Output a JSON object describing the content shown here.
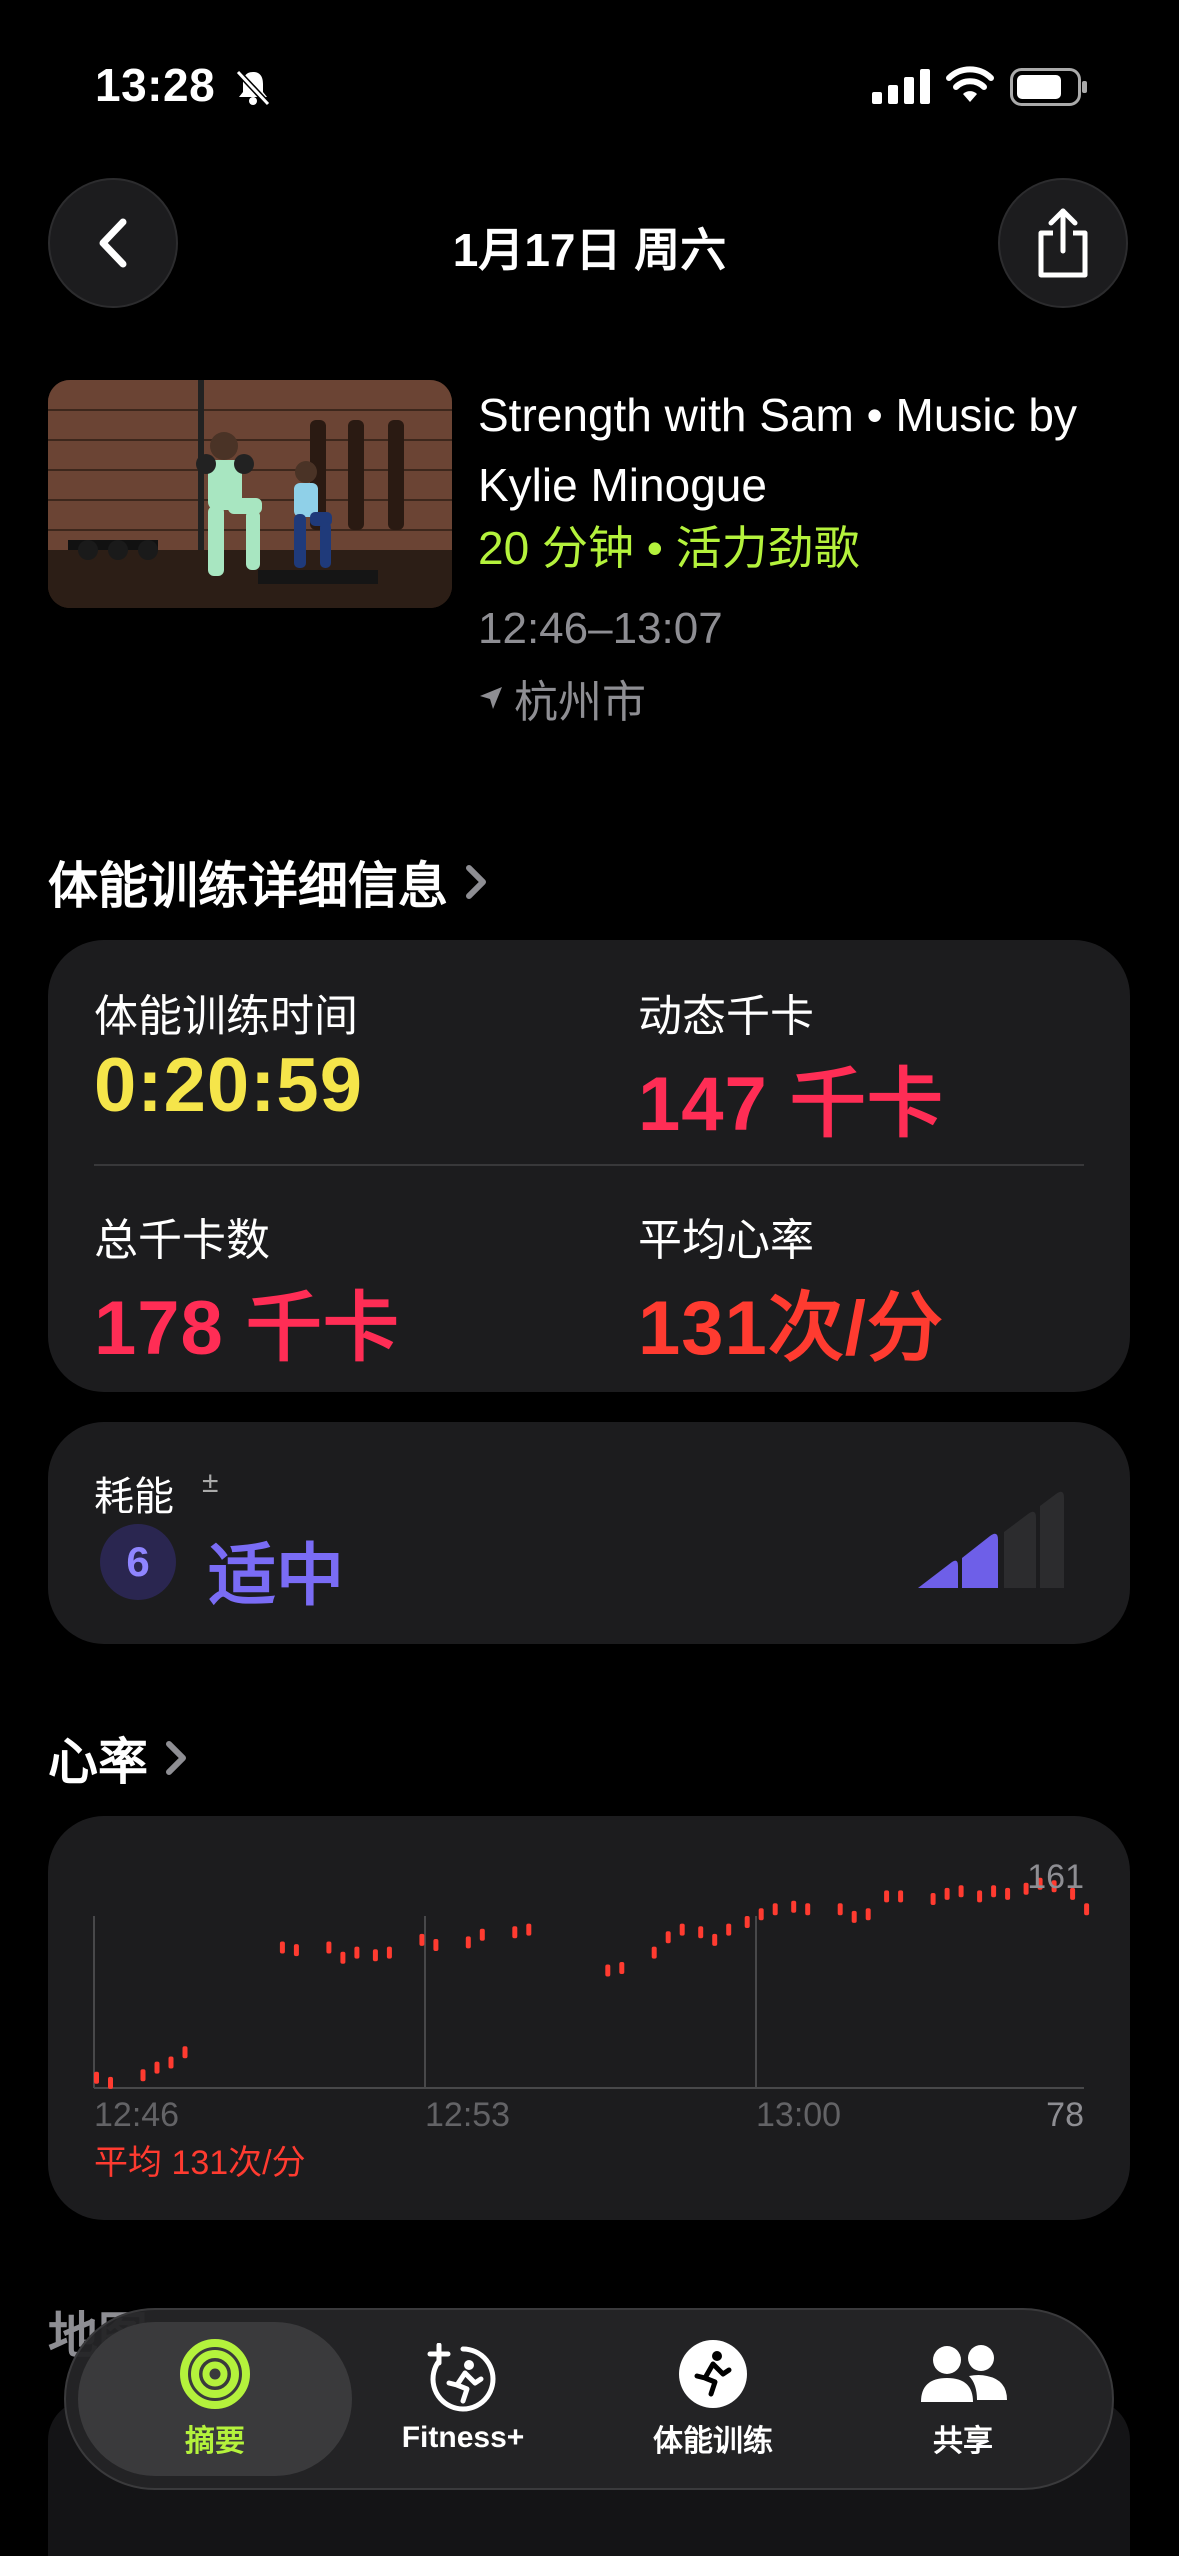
{
  "status_bar": {
    "time": "13:28"
  },
  "header": {
    "date": "1月17日 周六"
  },
  "workout": {
    "title": "Strength with Sam • Music by Kylie Minogue",
    "subtitle": "20 分钟 • 活力劲歌",
    "time_range": "12:46–13:07",
    "location": "杭州市"
  },
  "details": {
    "section_title": "体能训练详细信息",
    "metrics": [
      {
        "label": "体能训练时间",
        "value": "0:20:59",
        "color": "#f5e54a"
      },
      {
        "label": "动态千卡",
        "value": "147 千卡",
        "color": "#ff2d55"
      },
      {
        "label": "总千卡数",
        "value": "178 千卡",
        "color": "#ff2d55"
      },
      {
        "label": "平均心率",
        "value": "131次/分",
        "color": "#ff3b30"
      }
    ]
  },
  "effort": {
    "label": "耗能",
    "plus_minus": "±",
    "level": "6",
    "level_text": "适中",
    "color": "#7a6cf5"
  },
  "heart_rate": {
    "section_title": "心率",
    "average": "平均 131次/分"
  },
  "chart_data": {
    "type": "scatter",
    "title": "",
    "xlabel": "",
    "ylabel": "",
    "x_ticks": [
      "12:46",
      "12:53",
      "13:00"
    ],
    "y_max_label": "161",
    "y_min_label": "78",
    "ylim": [
      78,
      161
    ],
    "series": [
      {
        "values": [
          [
            "12:46",
            82
          ],
          [
            "12:46",
            80
          ],
          [
            "12:47",
            83
          ],
          [
            "12:47",
            86
          ],
          [
            "12:47",
            88
          ],
          [
            "12:47",
            92
          ],
          [
            "12:50",
            133
          ],
          [
            "12:50",
            132
          ],
          [
            "12:51",
            133
          ],
          [
            "12:51",
            129
          ],
          [
            "12:51",
            131
          ],
          [
            "12:52",
            130
          ],
          [
            "12:52",
            131
          ],
          [
            "12:53",
            136
          ],
          [
            "12:53",
            134
          ],
          [
            "12:54",
            135
          ],
          [
            "12:54",
            138
          ],
          [
            "12:55",
            139
          ],
          [
            "12:55",
            140
          ],
          [
            "12:57",
            124
          ],
          [
            "12:57",
            125
          ],
          [
            "12:58",
            131
          ],
          [
            "12:58",
            137
          ],
          [
            "12:58",
            140
          ],
          [
            "12:59",
            139
          ],
          [
            "12:59",
            136
          ],
          [
            "12:59",
            140
          ],
          [
            "13:00",
            143
          ],
          [
            "13:00",
            146
          ],
          [
            "13:00",
            148
          ],
          [
            "13:01",
            149
          ],
          [
            "13:01",
            148
          ],
          [
            "13:02",
            148
          ],
          [
            "13:02",
            145
          ],
          [
            "13:02",
            146
          ],
          [
            "13:03",
            153
          ],
          [
            "13:03",
            153
          ],
          [
            "13:04",
            152
          ],
          [
            "13:04",
            154
          ],
          [
            "13:04",
            155
          ],
          [
            "13:05",
            153
          ],
          [
            "13:05",
            155
          ],
          [
            "13:05",
            154
          ],
          [
            "13:06",
            156
          ],
          [
            "13:06",
            158
          ],
          [
            "13:06",
            157
          ],
          [
            "13:07",
            154
          ],
          [
            "13:07",
            148
          ]
        ]
      }
    ],
    "color": "#ff3b30"
  },
  "tabbar": {
    "tabs": [
      {
        "label": "摘要",
        "icon": "activity-rings-icon",
        "active": true
      },
      {
        "label": "Fitness+",
        "icon": "fitness-plus-icon",
        "active": false
      },
      {
        "label": "体能训练",
        "icon": "workout-runner-icon",
        "active": false
      },
      {
        "label": "共享",
        "icon": "people-icon",
        "active": false
      }
    ]
  },
  "background_section": {
    "label": "地图"
  }
}
